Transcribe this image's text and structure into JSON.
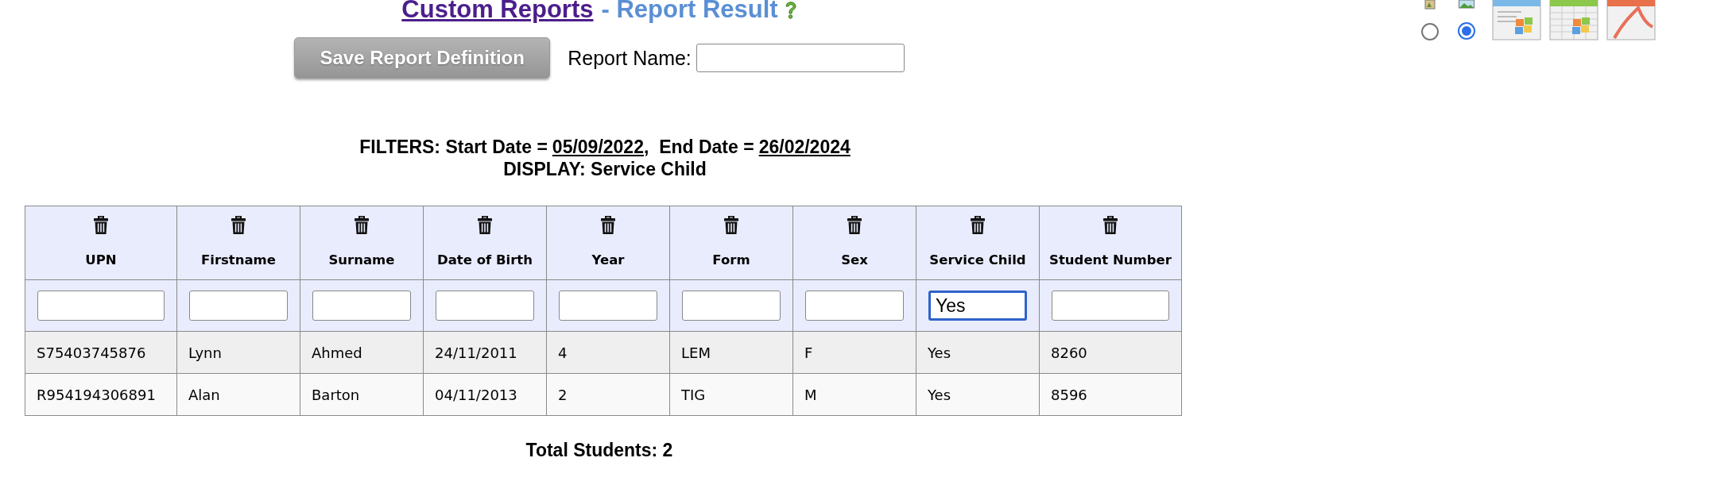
{
  "title": {
    "link": "Custom Reports",
    "suffix": "- Report Result"
  },
  "save_button": {
    "label": "Save Report Definition",
    "disabled": true
  },
  "report_name": {
    "label": "Report Name:"
  },
  "image_options": [
    {
      "selected": false
    },
    {
      "selected": true
    }
  ],
  "filters": {
    "start_label": "FILTERS: Start Date =",
    "start_date": "05/09/2022",
    "end_label": ",  End Date =",
    "end_date": "26/02/2024",
    "display": "DISPLAY: Service Child"
  },
  "table": {
    "columns": [
      {
        "label": "UPN",
        "focused": false
      },
      {
        "label": "Firstname",
        "focused": false
      },
      {
        "label": "Surname",
        "focused": false
      },
      {
        "label": "Date of Birth",
        "focused": false
      },
      {
        "label": "Year",
        "focused": false
      },
      {
        "label": "Form",
        "focused": false
      },
      {
        "label": "Sex",
        "focused": false
      },
      {
        "label": "Service Child",
        "filter": "Yes",
        "focused": true
      },
      {
        "label": "Student Number",
        "focused": false
      }
    ],
    "rows": [
      [
        "S75403745876",
        "Lynn",
        "Ahmed",
        "24/11/2011",
        "4",
        "LEM",
        "F",
        "Yes",
        "8260"
      ],
      [
        "R954194306891",
        "Alan",
        "Barton",
        "04/11/2013",
        "2",
        "TIG",
        "M",
        "Yes",
        "8596"
      ]
    ]
  },
  "total": "Total Students: 2"
}
